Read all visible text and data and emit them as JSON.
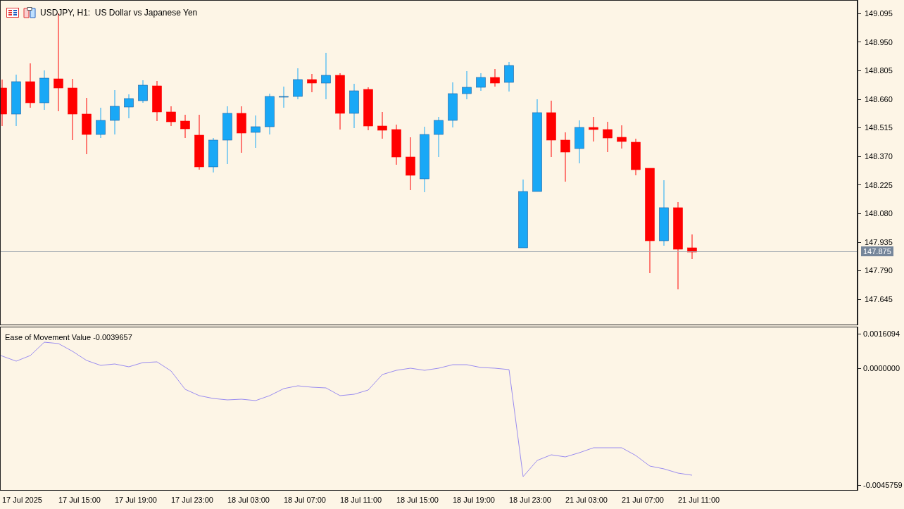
{
  "chart": {
    "title": "USDJPY, H1:  US Dollar vs Japanese Yen",
    "price_ticks": [
      "149.095",
      "148.950",
      "148.805",
      "148.660",
      "148.515",
      "148.370",
      "148.225",
      "148.080",
      "147.935",
      "147.790",
      "147.645"
    ],
    "current_price": "147.875"
  },
  "indicator": {
    "title": "Ease of Movement Value -0.0039657",
    "ticks": [
      "0.0016094",
      "0.0000000",
      "-0.0045759"
    ]
  },
  "time_axis": [
    "17 Jul 2025",
    "17 Jul 15:00",
    "17 Jul 19:00",
    "17 Jul 23:00",
    "18 Jul 03:00",
    "18 Jul 07:00",
    "18 Jul 11:00",
    "18 Jul 15:00",
    "18 Jul 19:00",
    "18 Jul 23:00",
    "21 Jul 03:00",
    "21 Jul 07:00",
    "21 Jul 11:00"
  ]
}
